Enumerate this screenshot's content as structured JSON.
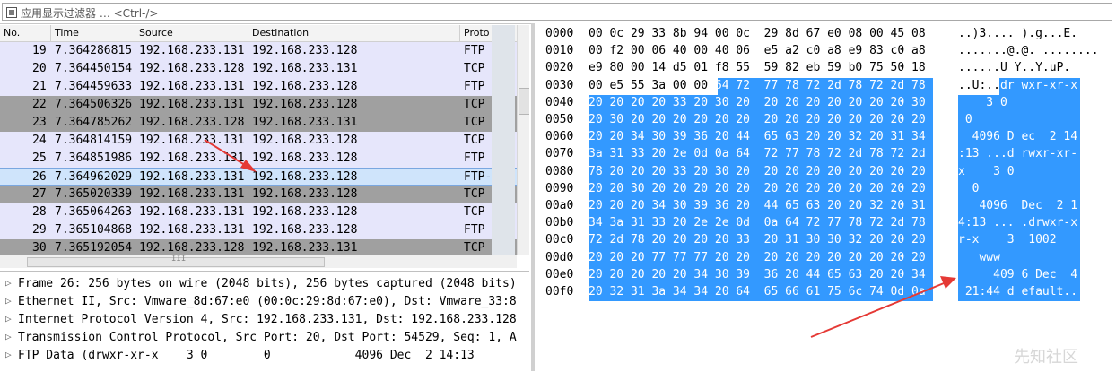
{
  "filter": {
    "placeholder": "应用显示过滤器 … <Ctrl-/>"
  },
  "packet_list": {
    "headers": [
      "No.",
      "Time",
      "Source",
      "Destination",
      "Proto"
    ],
    "rows": [
      {
        "no": "19",
        "time": "7.364286815",
        "src": "192.168.233.131",
        "dst": "192.168.233.128",
        "proto": "FTP"
      },
      {
        "no": "20",
        "time": "7.364450154",
        "src": "192.168.233.128",
        "dst": "192.168.233.131",
        "proto": "TCP"
      },
      {
        "no": "21",
        "time": "7.364459633",
        "src": "192.168.233.131",
        "dst": "192.168.233.128",
        "proto": "FTP"
      },
      {
        "no": "22",
        "time": "7.364506326",
        "src": "192.168.233.131",
        "dst": "192.168.233.128",
        "proto": "TCP"
      },
      {
        "no": "23",
        "time": "7.364785262",
        "src": "192.168.233.128",
        "dst": "192.168.233.131",
        "proto": "TCP"
      },
      {
        "no": "24",
        "time": "7.364814159",
        "src": "192.168.233.131",
        "dst": "192.168.233.128",
        "proto": "TCP"
      },
      {
        "no": "25",
        "time": "7.364851986",
        "src": "192.168.233.131",
        "dst": "192.168.233.128",
        "proto": "FTP"
      },
      {
        "no": "26",
        "time": "7.364962029",
        "src": "192.168.233.131",
        "dst": "192.168.233.128",
        "proto": "FTP-"
      },
      {
        "no": "27",
        "time": "7.365020339",
        "src": "192.168.233.131",
        "dst": "192.168.233.128",
        "proto": "TCP"
      },
      {
        "no": "28",
        "time": "7.365064263",
        "src": "192.168.233.131",
        "dst": "192.168.233.128",
        "proto": "TCP"
      },
      {
        "no": "29",
        "time": "7.365104868",
        "src": "192.168.233.131",
        "dst": "192.168.233.128",
        "proto": "FTP"
      },
      {
        "no": "30",
        "time": "7.365192054",
        "src": "192.168.233.128",
        "dst": "192.168.233.131",
        "proto": "TCP"
      }
    ],
    "hscroll_glyph": "III"
  },
  "details": [
    "Frame 26: 256 bytes on wire (2048 bits), 256 bytes captured (2048 bits)",
    "Ethernet II, Src: Vmware_8d:67:e0 (00:0c:29:8d:67:e0), Dst: Vmware_33:8",
    "Internet Protocol Version 4, Src: 192.168.233.131, Dst: 192.168.233.128",
    "Transmission Control Protocol, Src Port: 20, Dst Port: 54529, Seq: 1, A",
    "FTP Data (drwxr-xr-x    3 0        0            4096 Dec  2 14:13"
  ],
  "hex": {
    "offsets": [
      "0000",
      "0010",
      "0020",
      "0030",
      "0040",
      "0050",
      "0060",
      "0070",
      "0080",
      "0090",
      "00a0",
      "00b0",
      "00c0",
      "00d0",
      "00e0",
      "00f0"
    ],
    "bytes": [
      "00 0c 29 33 8b 94 00 0c  29 8d 67 e0 08 00 45 08",
      "00 f2 00 06 40 00 40 06  e5 a2 c0 a8 e9 83 c0 a8",
      "e9 80 00 14 d5 01 f8 55  59 82 eb 59 b0 75 50 18",
      "00 e5 55 3a 00 00 64 72  77 78 72 2d 78 72 2d 78",
      "20 20 20 20 33 20 30 20  20 20 20 20 20 20 20 30",
      "20 30 20 20 20 20 20 20  20 20 20 20 20 20 20 20",
      "20 20 34 30 39 36 20 44  65 63 20 20 32 20 31 34",
      "3a 31 33 20 2e 0d 0a 64  72 77 78 72 2d 78 72 2d",
      "78 20 20 20 33 20 30 20  20 20 20 20 20 20 20 20",
      "20 20 30 20 20 20 20 20  20 20 20 20 20 20 20 20",
      "20 20 20 34 30 39 36 20  44 65 63 20 20 32 20 31",
      "34 3a 31 33 20 2e 2e 0d  0a 64 72 77 78 72 2d 78",
      "72 2d 78 20 20 20 20 33  20 31 30 30 32 20 20 20",
      "20 20 20 77 77 77 20 20  20 20 20 20 20 20 20 20",
      "20 20 20 20 20 34 30 39  36 20 44 65 63 20 20 34",
      "20 32 31 3a 34 34 20 64  65 66 61 75 6c 74 0d 0a"
    ],
    "ascii": [
      "..)3.... ).g...E.",
      ".......@.@. ........",
      "......U Y..Y.uP.",
      "..U:..dr wxr-xr-x",
      "    3 0",
      " 0",
      "  4096 D ec  2 14",
      ":13 ...d rwxr-xr-",
      "x    3 0",
      "  0",
      "   4096  Dec  2 1",
      "4:13 ... .drwxr-x",
      "r-x    3  1002",
      "   www",
      "     409 6 Dec  4",
      " 21:44 d efault.."
    ]
  },
  "watermark": "先知社区"
}
